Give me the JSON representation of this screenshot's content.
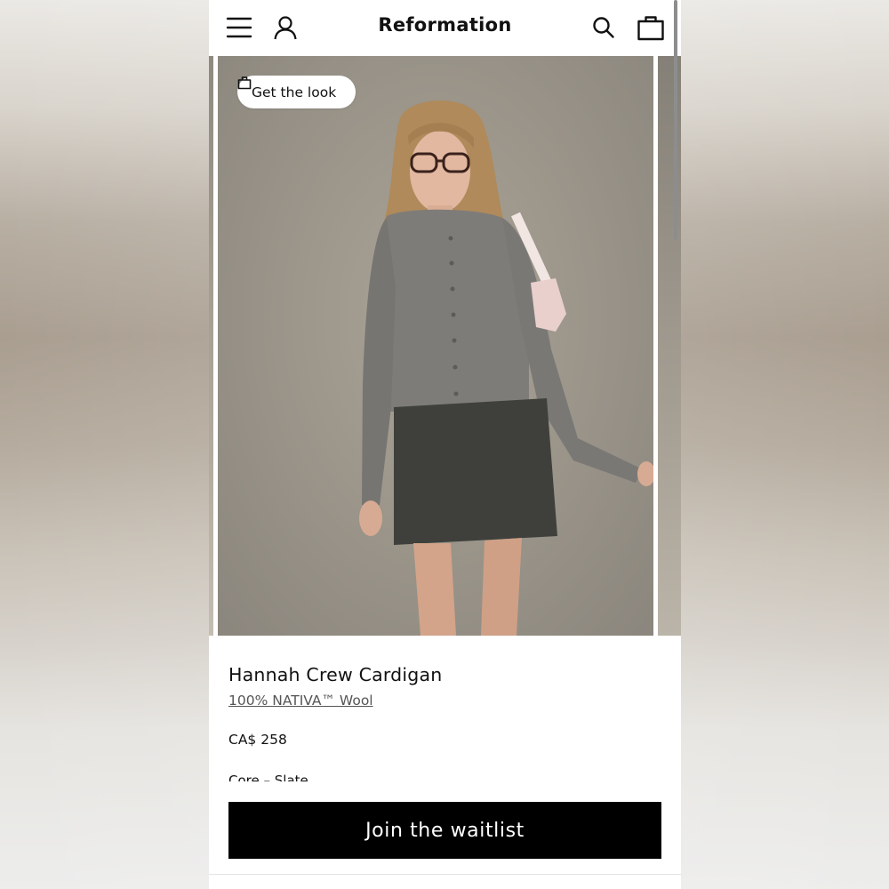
{
  "header": {
    "logo": "Reformation",
    "icons": [
      "menu-icon",
      "account-icon",
      "search-icon",
      "bag-icon"
    ]
  },
  "carousel": {
    "get_the_look_label": "Get the look"
  },
  "product": {
    "name": "Hannah Crew Cardigan",
    "material": "100% NATIVA™ Wool",
    "price": "CA$ 258",
    "color": "Core – Slate"
  },
  "cta": {
    "label": "Join the waitlist"
  },
  "colors": {
    "cta_bg": "#000000",
    "cta_text": "#ffffff",
    "background": "#ffffff"
  }
}
